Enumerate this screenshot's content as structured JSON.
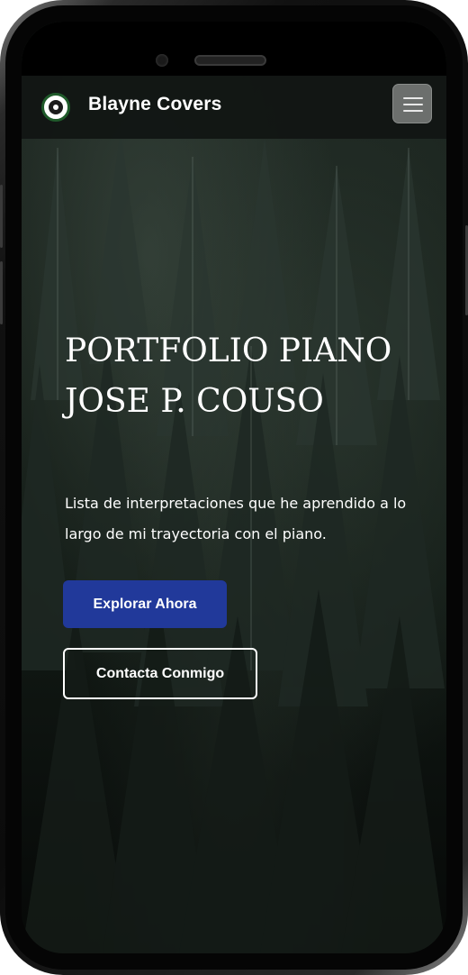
{
  "navbar": {
    "brand": "Blayne Covers",
    "logo_icon": "piano-logo-icon",
    "menu_icon": "hamburger-menu-icon"
  },
  "hero": {
    "title": "PORTFOLIO PIANO JOSE P. COUSO",
    "description": "Lista de interpretaciones que he aprendido a lo largo de mi trayectoria con el piano.",
    "primary_button": "Explorar Ahora",
    "secondary_button": "Contacta Conmigo"
  },
  "colors": {
    "primary": "#21399a",
    "navbar_bg": "#121614",
    "text": "#ffffff"
  }
}
